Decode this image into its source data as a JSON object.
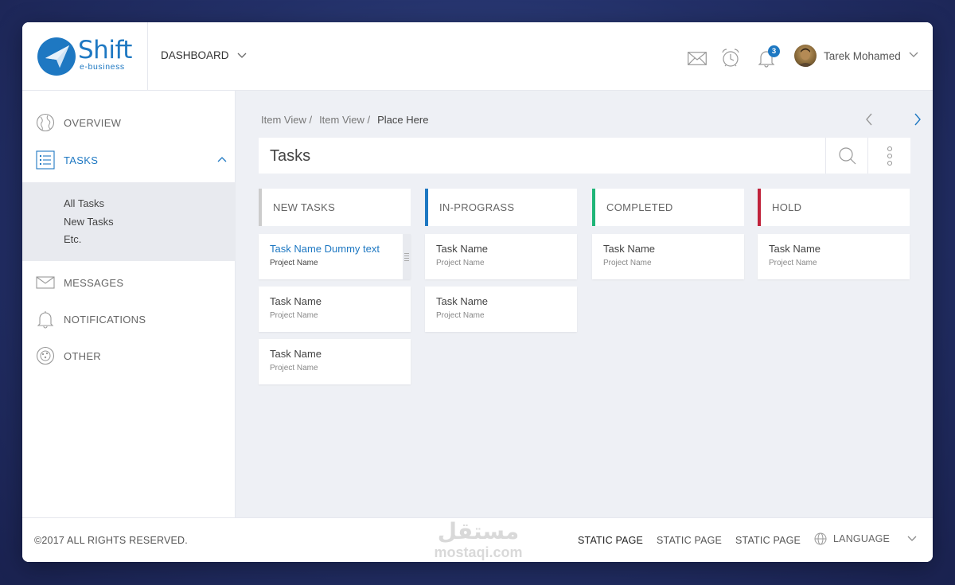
{
  "brand": {
    "name": "Shift",
    "tagline": "e-business",
    "color": "#1e78c2"
  },
  "header": {
    "dashboard_label": "DASHBOARD",
    "notification_count": "3",
    "user_name": "Tarek Mohamed",
    "icons": [
      "mail-icon",
      "alarm-clock-icon",
      "bell-icon",
      "chevron-down-icon"
    ]
  },
  "sidebar": {
    "items": [
      {
        "label": "OVERVIEW",
        "icon": "globe-icon"
      },
      {
        "label": "TASKS",
        "icon": "list-icon",
        "active": true
      },
      {
        "label": "MESSAGES",
        "icon": "mail-icon"
      },
      {
        "label": "NOTIFICATIONS",
        "icon": "bell-icon"
      },
      {
        "label": "OTHER",
        "icon": "dots-circle-icon"
      }
    ],
    "submenu": [
      "All Tasks",
      "New Tasks",
      "Etc."
    ]
  },
  "breadcrumb": [
    "Item View /",
    "Item View /",
    "Place Here"
  ],
  "page": {
    "title": "Tasks"
  },
  "columns": [
    {
      "title": "NEW TASKS",
      "color": "#cccccc",
      "cards": [
        {
          "name": "Task Name Dummy text",
          "project": "Project Name"
        },
        {
          "name": "Task Name",
          "project": "Project Name"
        },
        {
          "name": "Task Name",
          "project": "Project Name"
        }
      ]
    },
    {
      "title": "IN-PROGRASS",
      "color": "#1e78c2",
      "cards": [
        {
          "name": "Task Name",
          "project": "Project Name"
        },
        {
          "name": "Task Name",
          "project": "Project Name"
        }
      ]
    },
    {
      "title": "COMPLETED",
      "color": "#1fb578",
      "cards": [
        {
          "name": "Task Name",
          "project": "Project Name"
        }
      ]
    },
    {
      "title": "HOLD",
      "color": "#c0223b",
      "cards": [
        {
          "name": "Task Name",
          "project": "Project Name"
        }
      ]
    }
  ],
  "footer": {
    "copyright": "©2017 ALL RIGHTS RESERVED.",
    "links": [
      "STATIC PAGE",
      "STATIC PAGE",
      "STATIC PAGE"
    ],
    "language_label": "LANGUAGE"
  },
  "watermark": {
    "arabic": "مستقل",
    "latin": "mostaqi.com"
  }
}
